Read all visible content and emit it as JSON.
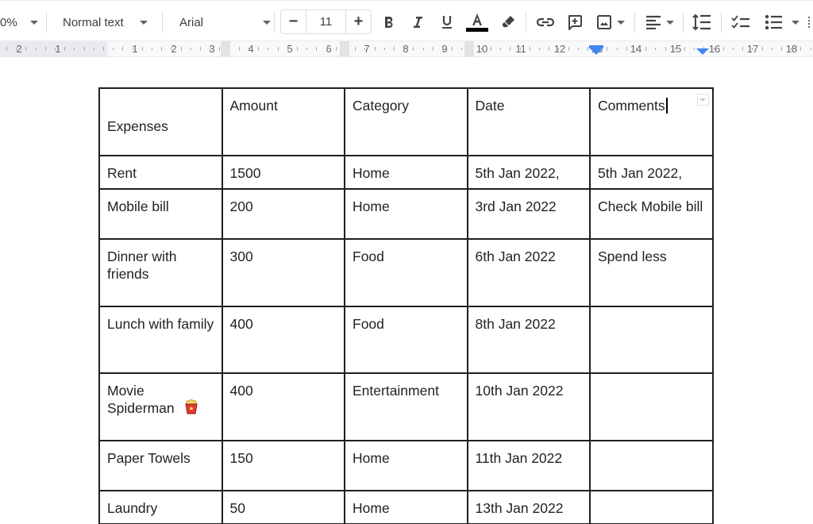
{
  "toolbar": {
    "zoom": "0%",
    "style": "Normal text",
    "font": "Arial",
    "font_size": "11",
    "minus": "−",
    "plus": "+",
    "icons": [
      "bold-icon",
      "italic-icon",
      "underline-icon",
      "text-color-icon",
      "highlight-icon",
      "link-icon",
      "add-comment-icon",
      "insert-image-icon",
      "align-icon",
      "line-spacing-icon",
      "checklist-icon",
      "bulleted-list-icon"
    ],
    "text_color": "#000000"
  },
  "ruler": {
    "labels": [
      "2",
      "1",
      "1",
      "2",
      "3",
      "4",
      "5",
      "6",
      "7",
      "8",
      "9",
      "10",
      "11",
      "12",
      "13",
      "14",
      "15",
      "16",
      "17",
      "18"
    ],
    "marker_color": "#4285f4"
  },
  "table": {
    "headers": [
      "Expenses",
      "Amount",
      "Category",
      "Date",
      "Comments"
    ],
    "rows": [
      [
        "Rent",
        "1500",
        "Home",
        "5th Jan 2022,",
        "5th Jan 2022,"
      ],
      [
        "Mobile bill",
        "200",
        "Home",
        "3rd Jan 2022",
        "Check Mobile bill"
      ],
      [
        "Dinner with friends",
        "300",
        "Food",
        "6th Jan 2022",
        "Spend less"
      ],
      [
        "Lunch with family",
        "400",
        "Food",
        "8th Jan 2022",
        ""
      ],
      [
        "Movie Spiderman",
        "400",
        "Entertainment",
        "10th Jan 2022",
        ""
      ],
      [
        "Paper Towels",
        "150",
        "Home",
        "11th Jan 2022",
        ""
      ],
      [
        "Laundry",
        "50",
        "Home",
        "13th Jan 2022",
        ""
      ]
    ],
    "emoji_row": 4,
    "emoji_icon": "popcorn-icon"
  }
}
